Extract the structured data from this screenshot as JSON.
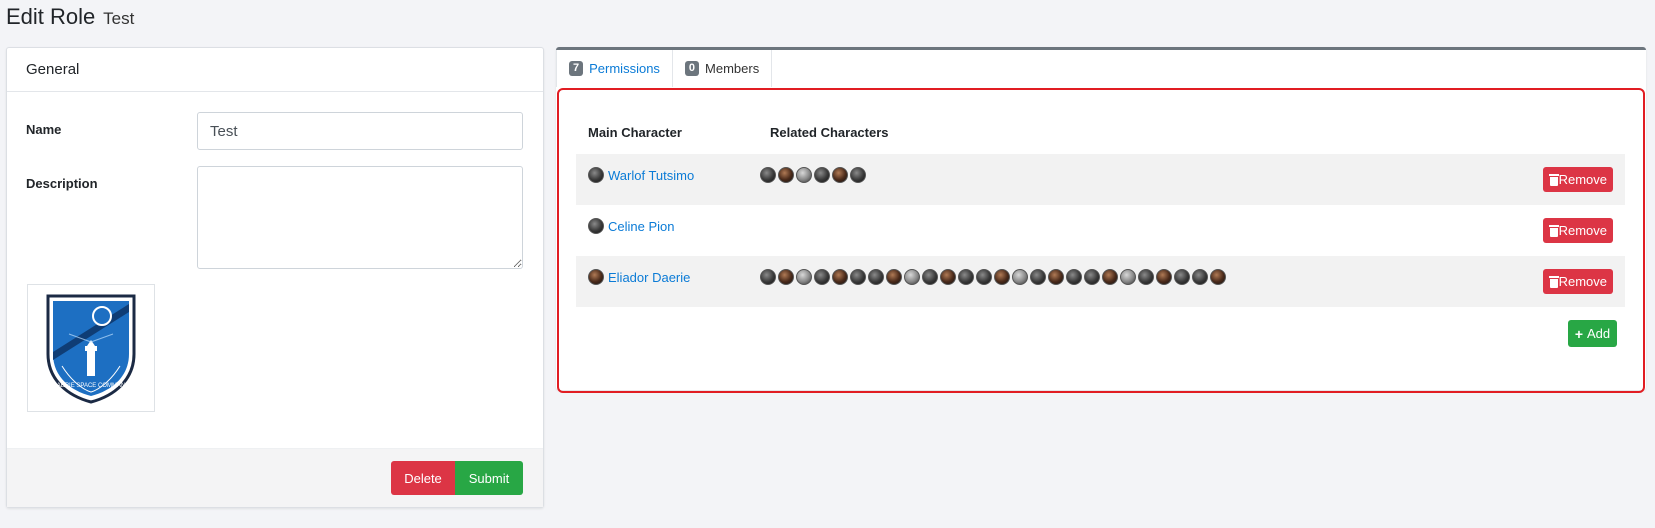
{
  "header": {
    "title": "Edit Role",
    "subtitle": "Test"
  },
  "general": {
    "title": "General",
    "name_label": "Name",
    "name_value": "Test",
    "description_label": "Description",
    "description_value": "",
    "logo_text": "DAERIE SPACE COMMAND",
    "delete_label": "Delete",
    "submit_label": "Submit"
  },
  "tabs": [
    {
      "count": "7",
      "label": "Permissions",
      "active": true
    },
    {
      "count": "0",
      "label": "Members",
      "active": false
    }
  ],
  "table": {
    "col_main": "Main Character",
    "col_related": "Related Characters",
    "rows": [
      {
        "main": "Warlof Tutsimo",
        "related_count": 6,
        "remove_label": "Remove"
      },
      {
        "main": "Celine Pion",
        "related_count": 0,
        "remove_label": "Remove"
      },
      {
        "main": "Eliador Daerie",
        "related_count": 26,
        "remove_label": "Remove"
      }
    ],
    "add_label": "Add"
  },
  "colors": {
    "link": "#0b7bd6",
    "danger": "#dc3545",
    "success": "#28a745",
    "highlight": "#e11d23"
  }
}
